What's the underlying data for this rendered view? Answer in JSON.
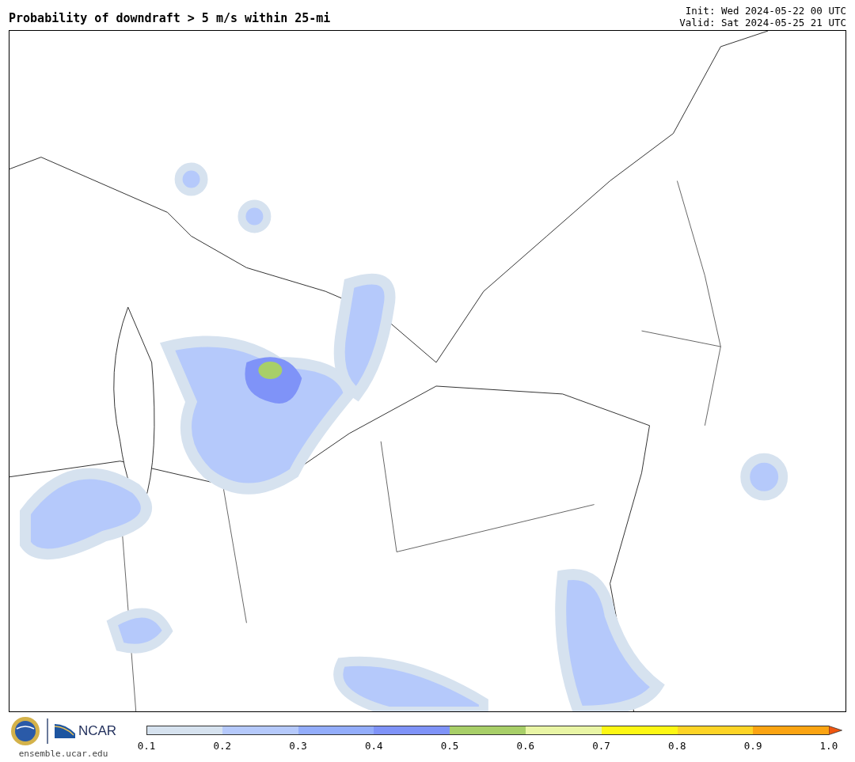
{
  "header": {
    "title": "Probability of downdraft > 5 m/s within 25-mi",
    "init": "Init: Wed 2024-05-22 00 UTC",
    "valid": "Valid: Sat 2024-05-25 21 UTC"
  },
  "colorbar": {
    "bins": [
      {
        "kind": "box",
        "color": "#d6e2ef"
      },
      {
        "kind": "box",
        "color": "#b5c9fb"
      },
      {
        "kind": "box",
        "color": "#93adfb"
      },
      {
        "kind": "box",
        "color": "#7f93f8"
      },
      {
        "kind": "box",
        "color": "#a8cf68"
      },
      {
        "kind": "box",
        "color": "#e9f5a5"
      },
      {
        "kind": "box",
        "color": "#fdf714"
      },
      {
        "kind": "box",
        "color": "#fdd426"
      },
      {
        "kind": "box",
        "color": "#fba412"
      },
      {
        "kind": "arrow",
        "color": "#f0560f"
      }
    ],
    "ticks": [
      "0.1",
      "0.2",
      "0.3",
      "0.4",
      "0.5",
      "0.6",
      "0.7",
      "0.8",
      "0.9",
      "1.0"
    ]
  },
  "footer": {
    "logo_text": "NCAR",
    "site": "ensemble.ucar.edu"
  }
}
